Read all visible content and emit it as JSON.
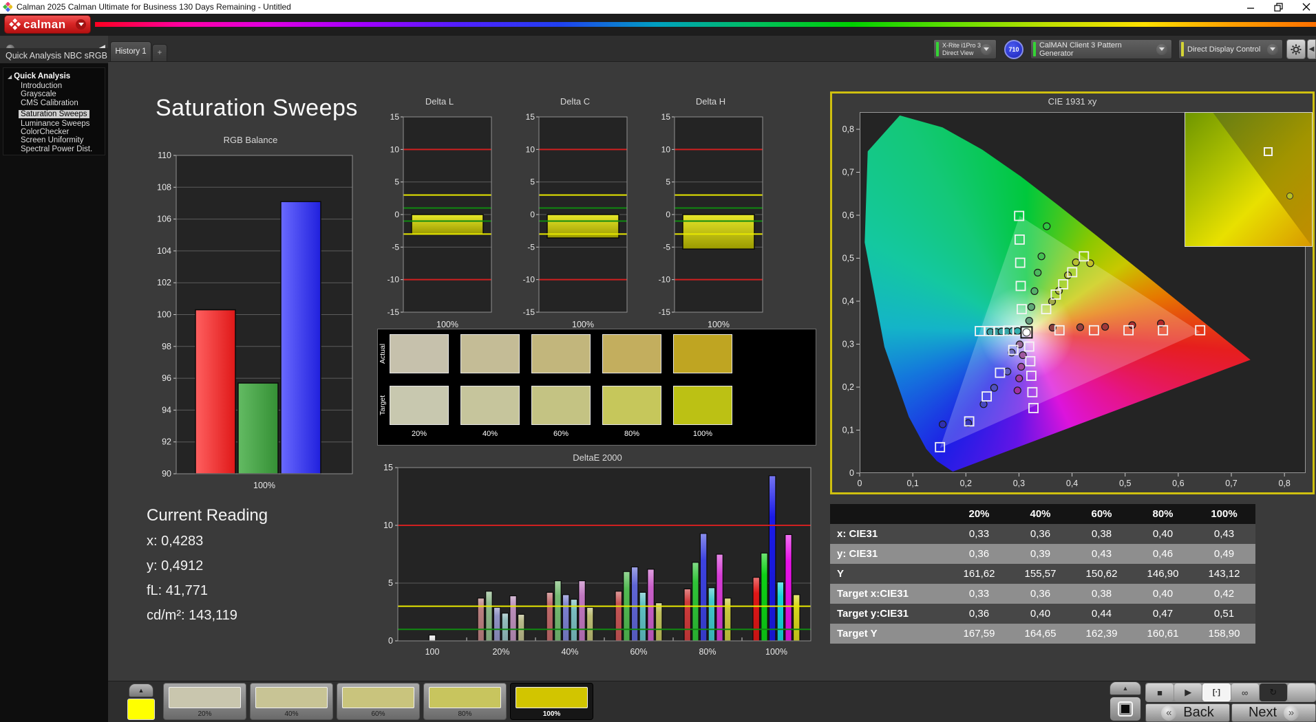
{
  "window": {
    "title": "Calman 2025 Calman Ultimate for Business 130 Days Remaining  - Untitled"
  },
  "logo": {
    "label": "calman"
  },
  "tabbar": {
    "tabs": [
      {
        "label": "History 1"
      },
      {
        "label": "+"
      }
    ]
  },
  "toolbar": {
    "meter": {
      "line1": "X-Rite i1Pro 3",
      "line2": "Direct View",
      "status_color": "#35d435",
      "badge": "710"
    },
    "source": {
      "label": "CalMAN Client 3 Pattern Generator",
      "status_color": "#35d435"
    },
    "display": {
      "label": "Direct Display Control",
      "status_color": "#d4d435"
    }
  },
  "sidebar": {
    "header": "Quick Analysis NBC sRGB",
    "root": "Quick Analysis",
    "items": [
      "Introduction",
      "Grayscale",
      "CMS Calibration",
      "Saturation Sweeps",
      "Luminance Sweeps",
      "ColorChecker",
      "Screen Uniformity",
      "Spectral Power Dist."
    ],
    "selected_index": 3
  },
  "page": {
    "title": "Saturation Sweeps"
  },
  "current_reading": {
    "title": "Current Reading",
    "x": "x: 0,4283",
    "y": "y: 0,4912",
    "fl": "fL: 41,771",
    "cdm2": "cd/m²: 143,119"
  },
  "swatch_panel": {
    "row_labels": [
      "Actual",
      "Target"
    ],
    "level_labels": [
      "20%",
      "40%",
      "60%",
      "80%",
      "100%"
    ],
    "actual_colors": [
      "#c6c1ac",
      "#c4bc96",
      "#c2b67c",
      "#c3ae5e",
      "#bfa522"
    ],
    "target_colors": [
      "#c8c8af",
      "#c6c59c",
      "#c4c383",
      "#c6c75b",
      "#bcc114"
    ]
  },
  "table": {
    "col_headers": [
      "",
      "20%",
      "40%",
      "60%",
      "80%",
      "100%"
    ],
    "rows": [
      {
        "label": "x: CIE31",
        "values": [
          "0,33",
          "0,36",
          "0,38",
          "0,40",
          "0,43"
        ]
      },
      {
        "label": "y: CIE31",
        "values": [
          "0,36",
          "0,39",
          "0,43",
          "0,46",
          "0,49"
        ]
      },
      {
        "label": "Y",
        "values": [
          "161,62",
          "155,57",
          "150,62",
          "146,90",
          "143,12"
        ]
      },
      {
        "label": "Target x:CIE31",
        "values": [
          "0,33",
          "0,36",
          "0,38",
          "0,40",
          "0,42"
        ]
      },
      {
        "label": "Target y:CIE31",
        "values": [
          "0,36",
          "0,40",
          "0,44",
          "0,47",
          "0,51"
        ]
      },
      {
        "label": "Target Y",
        "values": [
          "167,59",
          "164,65",
          "162,39",
          "160,61",
          "158,90"
        ]
      }
    ]
  },
  "bottom": {
    "pattern_color": "#ffff00",
    "levels": [
      {
        "label": "20%",
        "color": "#c9c6ae"
      },
      {
        "label": "40%",
        "color": "#c8c495"
      },
      {
        "label": "60%",
        "color": "#c9c47d"
      },
      {
        "label": "80%",
        "color": "#c8c55e"
      },
      {
        "label": "100%",
        "color": "#d2c500",
        "selected": true
      }
    ],
    "transport": [
      {
        "name": "stop",
        "glyph": "■"
      },
      {
        "name": "play",
        "glyph": "▶"
      },
      {
        "name": "pattern-window",
        "glyph": "[·]",
        "active": true
      },
      {
        "name": "loop",
        "glyph": "∞"
      },
      {
        "name": "resume",
        "glyph": "↻",
        "dark": true
      },
      {
        "name": "blank",
        "glyph": ""
      }
    ],
    "back": "Back",
    "next": "Next",
    "back_chevron": "«",
    "next_chevron": "»"
  },
  "chart_data": {
    "rgb_balance": {
      "type": "bar",
      "title": "RGB Balance",
      "xlabel": "100%",
      "ylim": [
        90,
        110
      ],
      "ytick_step": 2,
      "series": [
        {
          "name": "Red",
          "value": 100.3,
          "color": "#ff6060",
          "color2": "#df1818"
        },
        {
          "name": "Green",
          "value": 95.7,
          "color": "#63bb63",
          "color2": "#359035"
        },
        {
          "name": "Blue",
          "value": 107.1,
          "color": "#6a6aff",
          "color2": "#2020dd"
        }
      ]
    },
    "delta_axis": {
      "ylim": [
        -15,
        15
      ],
      "step": 5,
      "ref_red": 10,
      "ref_yellow": 3,
      "ref_green": 1,
      "xlabel": "100%",
      "bar_color": "#e8e82a",
      "bar_color2": "#9a9a00"
    },
    "delta_charts": [
      {
        "title": "Delta L",
        "value": -3.0
      },
      {
        "title": "Delta C",
        "value": -3.6
      },
      {
        "title": "Delta H",
        "value": -5.3
      }
    ],
    "deltae2000": {
      "type": "bar",
      "title": "DeltaE 2000",
      "ylim": [
        0,
        15
      ],
      "yticks": [
        0,
        5,
        10,
        15
      ],
      "ref_lines": [
        {
          "v": 10,
          "color": "#d02020"
        },
        {
          "v": 3,
          "color": "#e8e800"
        },
        {
          "v": 1,
          "color": "#108a10"
        }
      ],
      "groups": [
        {
          "label": "100",
          "values": [
            0.5
          ],
          "colors": [
            "#f2f2f2"
          ]
        },
        {
          "label": "20%",
          "values": [
            3.7,
            4.3,
            2.9,
            2.4,
            3.9,
            2.3
          ],
          "colors": [
            "#b97f7f",
            "#8fb98a",
            "#9093c4",
            "#92bcbc",
            "#bb8fbb",
            "#b9b98a"
          ]
        },
        {
          "label": "40%",
          "values": [
            4.2,
            5.2,
            4.0,
            3.6,
            5.2,
            2.9
          ],
          "colors": [
            "#c06a6a",
            "#76bb72",
            "#7b80cf",
            "#79bcbf",
            "#c077c0",
            "#bcbc74"
          ]
        },
        {
          "label": "60%",
          "values": [
            4.3,
            6.0,
            6.4,
            4.2,
            6.2,
            3.3
          ],
          "colors": [
            "#c75555",
            "#52bb52",
            "#5f65d6",
            "#5fc0c3",
            "#ca5fca",
            "#c0c05c"
          ]
        },
        {
          "label": "80%",
          "values": [
            4.5,
            6.8,
            9.3,
            4.6,
            7.5,
            3.7
          ],
          "colors": [
            "#d03b3b",
            "#2fc437",
            "#3c42e0",
            "#40c7cb",
            "#d63bd6",
            "#c9c93e"
          ]
        },
        {
          "label": "100%",
          "values": [
            5.5,
            7.6,
            14.3,
            5.1,
            9.2,
            4.0
          ],
          "colors": [
            "#e01717",
            "#0ed116",
            "#1a1ae8",
            "#17d3da",
            "#e812e8",
            "#d6d61c"
          ]
        }
      ]
    },
    "cie": {
      "type": "scatter",
      "title": "CIE 1931 xy",
      "xlim": [
        0,
        0.8
      ],
      "ylim": [
        0,
        0.8
      ],
      "xticks": [
        "0",
        "0,1",
        "0,2",
        "0,3",
        "0,4",
        "0,5",
        "0,6",
        "0,7",
        "0,8"
      ],
      "yticks": [
        "0",
        "0,1",
        "0,2",
        "0,3",
        "0,4",
        "0,5",
        "0,6",
        "0,7",
        "0,8"
      ],
      "white_point": [
        0.313,
        0.329
      ],
      "targets": [
        [
          0.225,
          0.332
        ],
        [
          0.243,
          0.332
        ],
        [
          0.261,
          0.332
        ],
        [
          0.279,
          0.333
        ],
        [
          0.297,
          0.333
        ],
        [
          0.375,
          0.334
        ],
        [
          0.44,
          0.334
        ],
        [
          0.505,
          0.334
        ],
        [
          0.57,
          0.334
        ],
        [
          0.64,
          0.334
        ],
        [
          0.304,
          0.383
        ],
        [
          0.302,
          0.437
        ],
        [
          0.301,
          0.491
        ],
        [
          0.3,
          0.545
        ],
        [
          0.299,
          0.6
        ],
        [
          0.288,
          0.288
        ],
        [
          0.263,
          0.235
        ],
        [
          0.238,
          0.18
        ],
        [
          0.205,
          0.122
        ],
        [
          0.15,
          0.062
        ],
        [
          0.318,
          0.296
        ],
        [
          0.32,
          0.262
        ],
        [
          0.322,
          0.228
        ],
        [
          0.324,
          0.19
        ],
        [
          0.326,
          0.153
        ],
        [
          0.35,
          0.383
        ],
        [
          0.368,
          0.417
        ],
        [
          0.382,
          0.441
        ],
        [
          0.399,
          0.469
        ],
        [
          0.421,
          0.506
        ]
      ],
      "measured": [
        [
          0.245,
          0.33,
          "#3aa0a0"
        ],
        [
          0.256,
          0.33,
          "#3aa0a0"
        ],
        [
          0.266,
          0.331,
          "#38a8a8"
        ],
        [
          0.276,
          0.331,
          "#38a8a8"
        ],
        [
          0.287,
          0.332,
          "#36b0b0"
        ],
        [
          0.296,
          0.332,
          "#36b0b0"
        ],
        [
          0.362,
          0.34,
          "#8a4040"
        ],
        [
          0.414,
          0.341,
          "#964040"
        ],
        [
          0.461,
          0.342,
          "#a03838"
        ],
        [
          0.512,
          0.346,
          "#aa3030"
        ],
        [
          0.566,
          0.35,
          "#b22828"
        ],
        [
          0.318,
          0.356,
          "#68a080"
        ],
        [
          0.322,
          0.388,
          "#60a878"
        ],
        [
          0.328,
          0.425,
          "#56b06a"
        ],
        [
          0.334,
          0.468,
          "#4cb85e"
        ],
        [
          0.341,
          0.506,
          "#44c052"
        ],
        [
          0.351,
          0.576,
          "#30c840"
        ],
        [
          0.361,
          0.401,
          "#a0a848"
        ],
        [
          0.374,
          0.426,
          "#a8b040"
        ],
        [
          0.391,
          0.462,
          "#b0b838"
        ],
        [
          0.406,
          0.492,
          "#b8c030"
        ],
        [
          0.433,
          0.49,
          "#c0c028"
        ],
        [
          0.3,
          0.301,
          "#9a6a9a"
        ],
        [
          0.306,
          0.276,
          "#a05aa0"
        ],
        [
          0.303,
          0.249,
          "#a04aa0"
        ],
        [
          0.299,
          0.222,
          "#a03aa0"
        ],
        [
          0.296,
          0.194,
          "#a030a0"
        ],
        [
          0.285,
          0.282,
          "#7070c0"
        ],
        [
          0.277,
          0.238,
          "#6060c0"
        ],
        [
          0.252,
          0.2,
          "#5050c0"
        ],
        [
          0.232,
          0.162,
          "#4848c0"
        ],
        [
          0.203,
          0.118,
          "#3838b8"
        ],
        [
          0.155,
          0.115,
          "#3030b0"
        ]
      ]
    }
  }
}
